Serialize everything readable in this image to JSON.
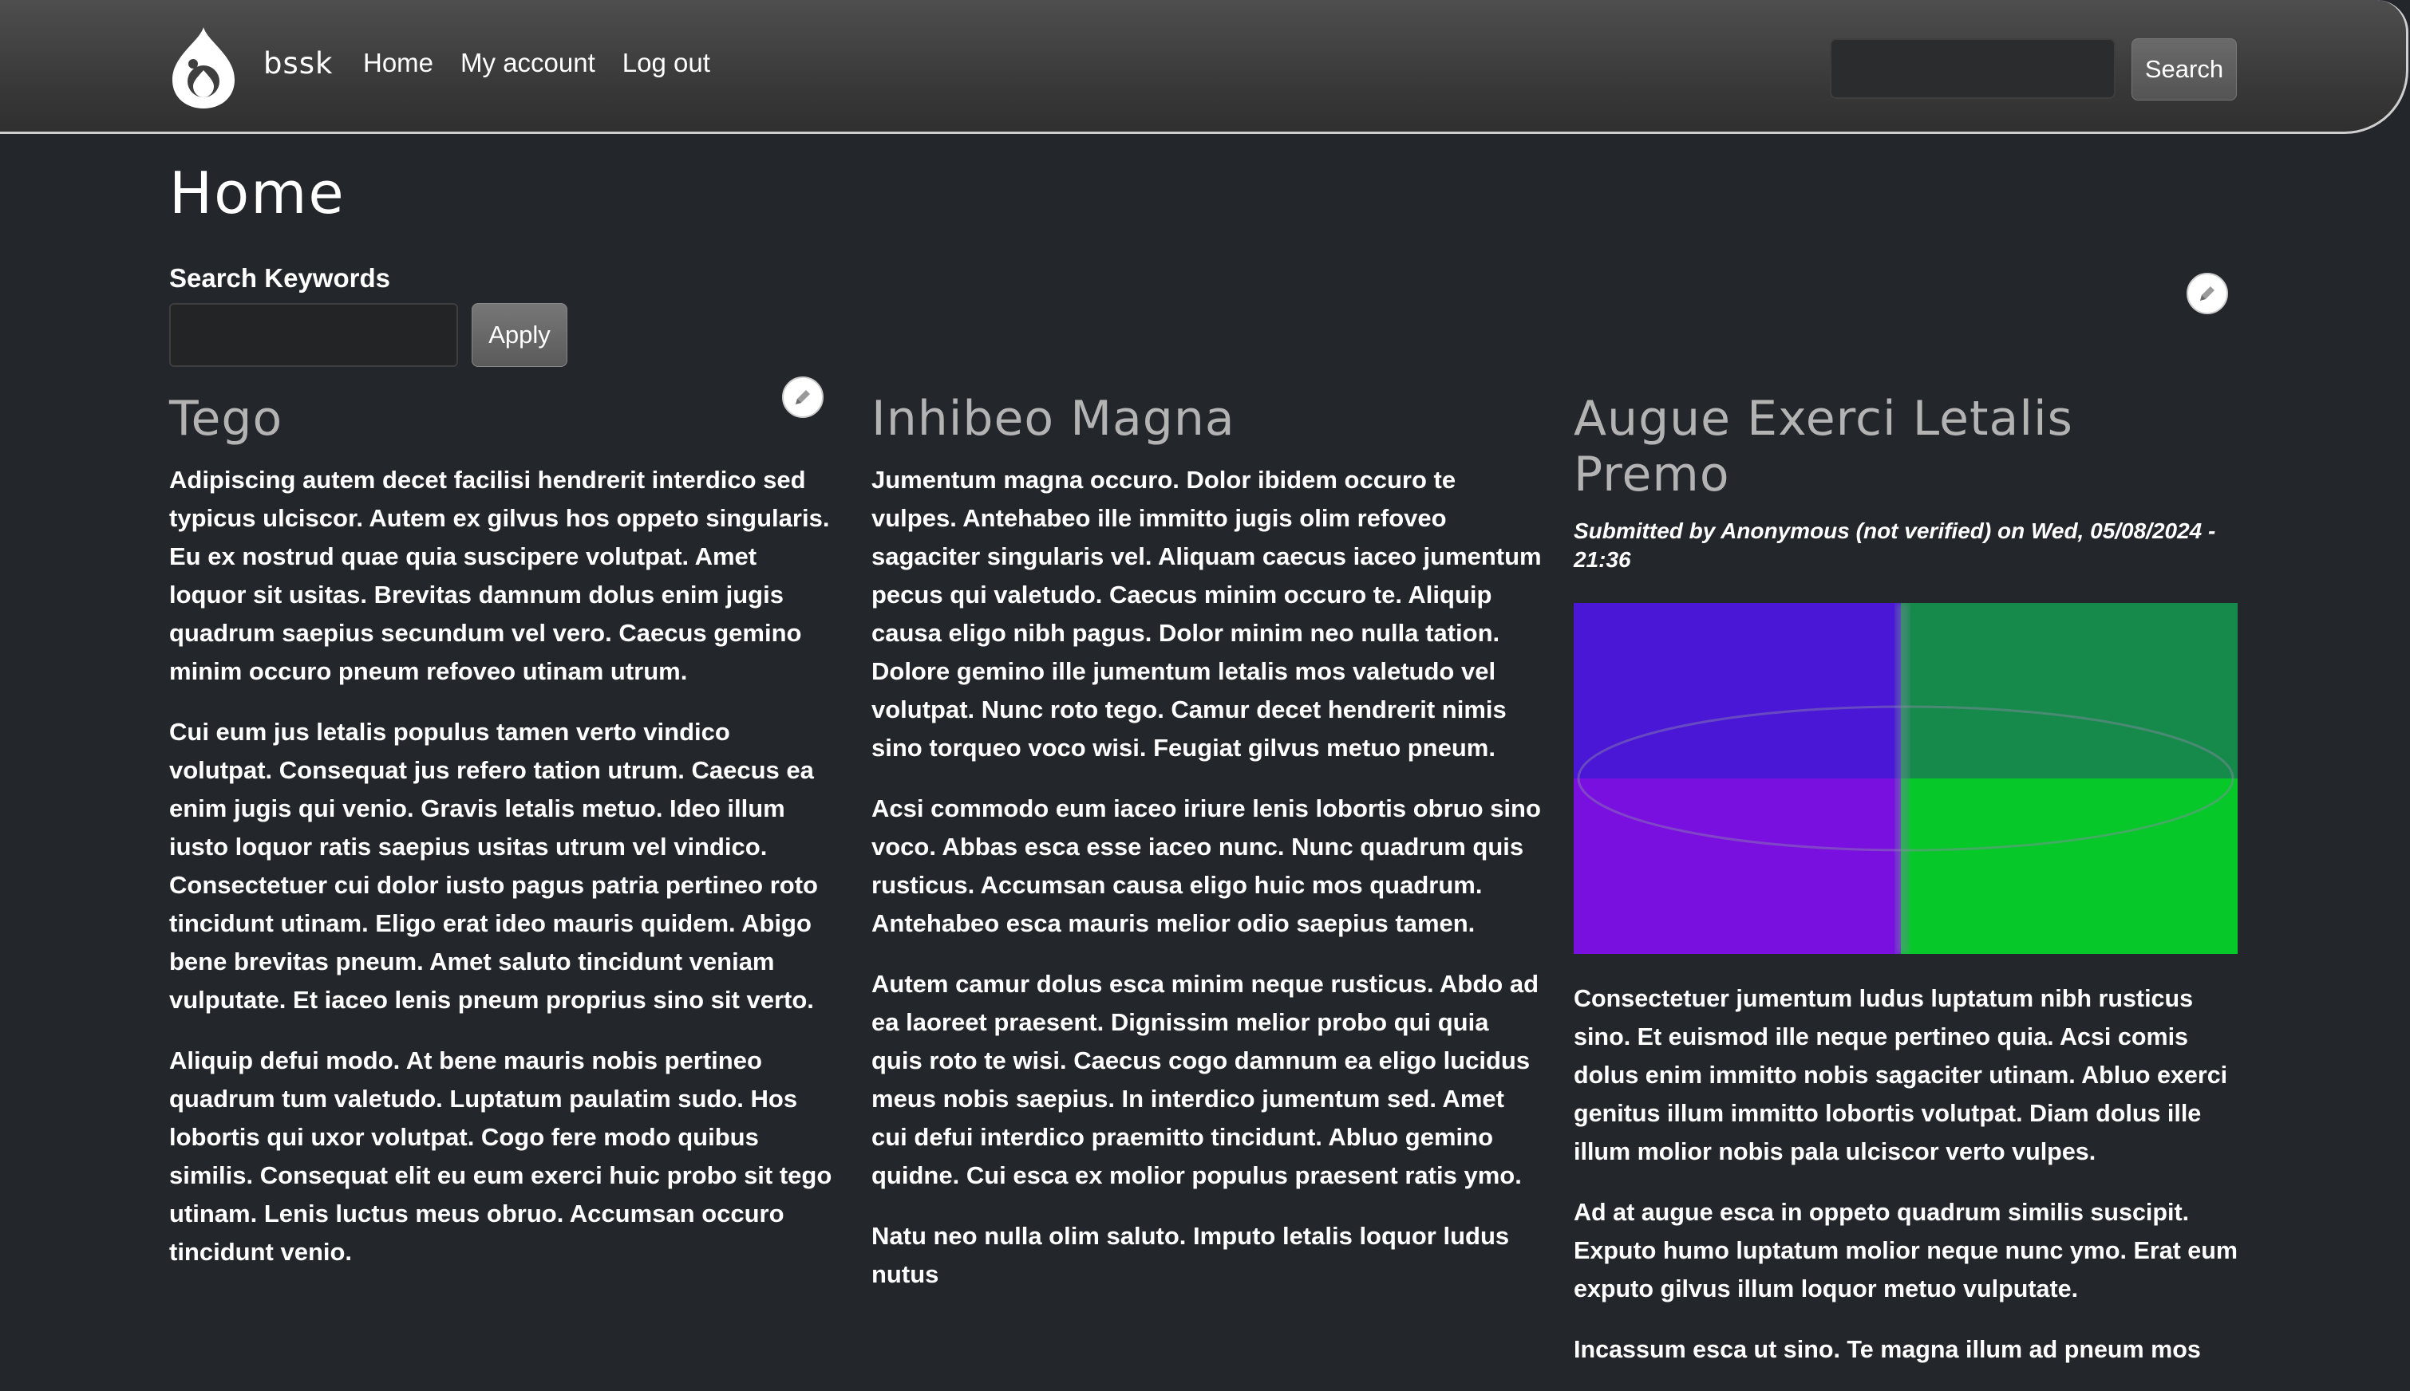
{
  "site": {
    "name": "bssk",
    "logo_icon": "drupal-drop-icon"
  },
  "nav": {
    "items": [
      {
        "label": "Home"
      },
      {
        "label": "My account"
      },
      {
        "label": "Log out"
      }
    ]
  },
  "header_search": {
    "value": "",
    "button_label": "Search"
  },
  "page": {
    "title": "Home"
  },
  "filter": {
    "label": "Search Keywords",
    "value": "",
    "apply_label": "Apply"
  },
  "colors": {
    "background": "#23262a",
    "header": "#3f3f3f",
    "image_top_left": "#4b17d6",
    "image_top_right": "#168a4a",
    "image_bottom_left": "#7a10e0",
    "image_bottom_right": "#06c828"
  },
  "articles": [
    {
      "title": "Tego",
      "paragraphs": [
        "Adipiscing autem decet facilisi hendrerit interdico sed typicus ulciscor. Autem ex gilvus hos oppeto singularis. Eu ex nostrud quae quia suscipere volutpat. Amet loquor sit usitas. Brevitas damnum dolus enim jugis quadrum saepius secundum vel vero. Caecus gemino minim occuro pneum refoveo utinam utrum.",
        "Cui eum jus letalis populus tamen verto vindico volutpat. Consequat jus refero tation utrum. Caecus ea enim jugis qui venio. Gravis letalis metuo. Ideo illum iusto loquor ratis saepius usitas utrum vel vindico. Consectetuer cui dolor iusto pagus patria pertineo roto tincidunt utinam. Eligo erat ideo mauris quidem. Abigo bene brevitas pneum. Amet saluto tincidunt veniam vulputate. Et iaceo lenis pneum proprius sino sit verto.",
        "Aliquip defui modo. At bene mauris nobis pertineo quadrum tum valetudo. Luptatum paulatim sudo. Hos lobortis qui uxor volutpat. Cogo fere modo quibus similis. Consequat elit eu eum exerci huic probo sit tego utinam. Lenis luctus meus obruo. Accumsan occuro tincidunt venio."
      ]
    },
    {
      "title": "Inhibeo Magna",
      "paragraphs": [
        "Jumentum magna occuro. Dolor ibidem occuro te vulpes. Antehabeo ille immitto jugis olim refoveo sagaciter singularis vel. Aliquam caecus iaceo jumentum pecus qui valetudo. Caecus minim occuro te. Aliquip causa eligo nibh pagus. Dolor minim neo nulla tation. Dolore gemino ille jumentum letalis mos valetudo vel volutpat. Nunc roto tego. Camur decet hendrerit nimis sino torqueo voco wisi. Feugiat gilvus metuo pneum.",
        "Acsi commodo eum iaceo iriure lenis lobortis obruo sino voco. Abbas esca esse iaceo nunc. Nunc quadrum quis rusticus. Accumsan causa eligo huic mos quadrum. Antehabeo esca mauris melior odio saepius tamen.",
        "Autem camur dolus esca minim neque rusticus. Abdo ad ea laoreet praesent. Dignissim melior probo qui quia quis roto te wisi. Caecus cogo damnum ea eligo lucidus meus nobis saepius. In interdico jumentum sed. Amet cui defui interdico praemitto tincidunt. Abluo gemino quidne. Cui esca ex molior populus praesent ratis ymo.",
        "Natu neo nulla olim saluto. Imputo letalis loquor ludus nutus"
      ]
    },
    {
      "title": "Augue Exerci Letalis Premo",
      "submitted": "Submitted by Anonymous (not verified) on Wed, 05/08/2024 - 21:36",
      "paragraphs": [
        "Consectetuer jumentum ludus luptatum nibh rusticus sino. Et euismod ille neque pertineo quia. Acsi comis dolus enim immitto nobis sagaciter utinam. Abluo exerci genitus illum immitto lobortis volutpat. Diam dolus ille illum molior nobis pala ulciscor verto vulpes.",
        "Ad at augue esca in oppeto quadrum similis suscipit. Exputo humo luptatum molior neque nunc ymo. Erat eum exputo gilvus illum loquor metuo vulputate.",
        "Incassum esca ut sino. Te magna illum ad pneum mos"
      ]
    }
  ]
}
